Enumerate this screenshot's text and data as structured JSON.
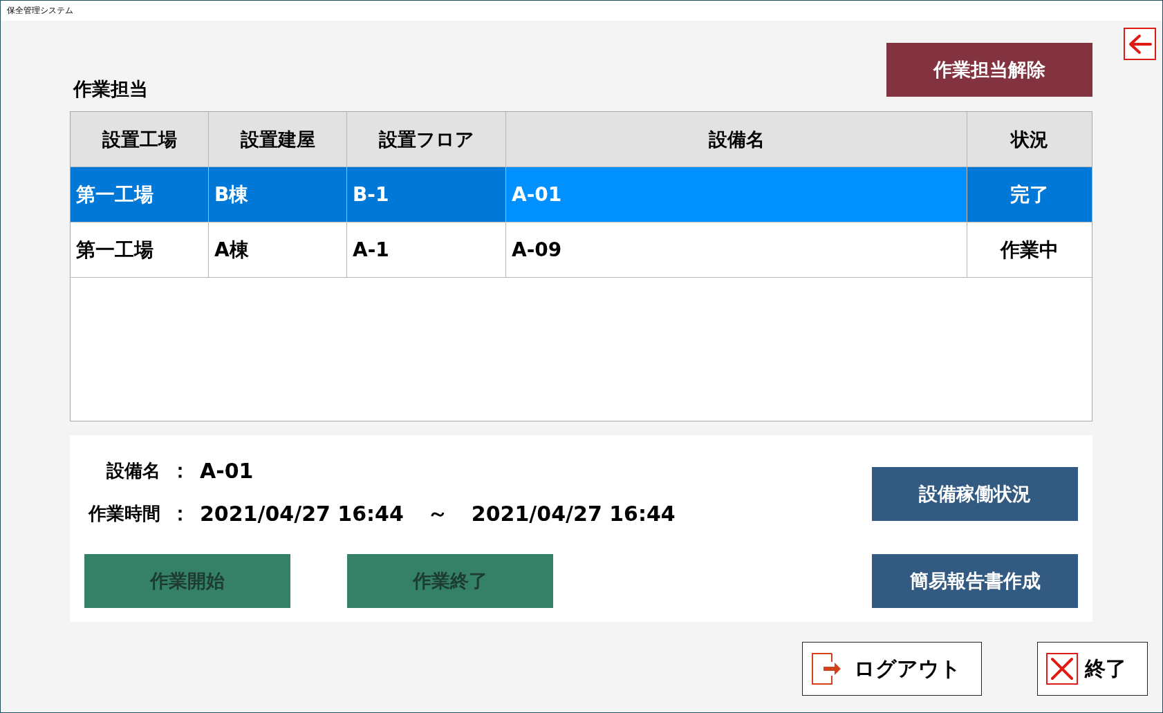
{
  "window": {
    "title": "保全管理システム"
  },
  "header": {
    "label": "作業担当",
    "release_button": "作業担当解除"
  },
  "table": {
    "columns": [
      "設置工場",
      "設置建屋",
      "設置フロア",
      "設備名",
      "状況"
    ],
    "rows": [
      {
        "selected": true,
        "cells": [
          {
            "text": "第一工場",
            "focused": false
          },
          {
            "text": "B棟",
            "focused": false
          },
          {
            "text": "B-1",
            "focused": false
          },
          {
            "text": "A-01",
            "focused": true
          },
          {
            "text": "完了",
            "focused": false
          }
        ]
      },
      {
        "selected": false,
        "cells": [
          {
            "text": "第一工場",
            "focused": false
          },
          {
            "text": "A棟",
            "focused": false
          },
          {
            "text": "A-1",
            "focused": false
          },
          {
            "text": "A-09",
            "focused": false
          },
          {
            "text": "作業中",
            "focused": false
          }
        ]
      }
    ]
  },
  "details": {
    "fields": [
      {
        "label": "設備名",
        "colon": "：",
        "values": [
          "A-01"
        ]
      },
      {
        "label": "作業時間",
        "colon": "：",
        "values": [
          "2021/04/27 16:44",
          "～",
          "2021/04/27 16:44"
        ]
      }
    ],
    "work_buttons": [
      {
        "label": "作業開始",
        "kind": "work"
      },
      {
        "label": "作業終了",
        "kind": "work"
      }
    ],
    "side_buttons": [
      {
        "label": "設備稼働状況",
        "kind": "report"
      },
      {
        "label": "簡易報告書作成",
        "kind": "report"
      }
    ]
  },
  "footer_buttons": [
    {
      "label": "ログアウト",
      "kind": "logout"
    },
    {
      "label": "終了",
      "kind": "exit"
    }
  ]
}
